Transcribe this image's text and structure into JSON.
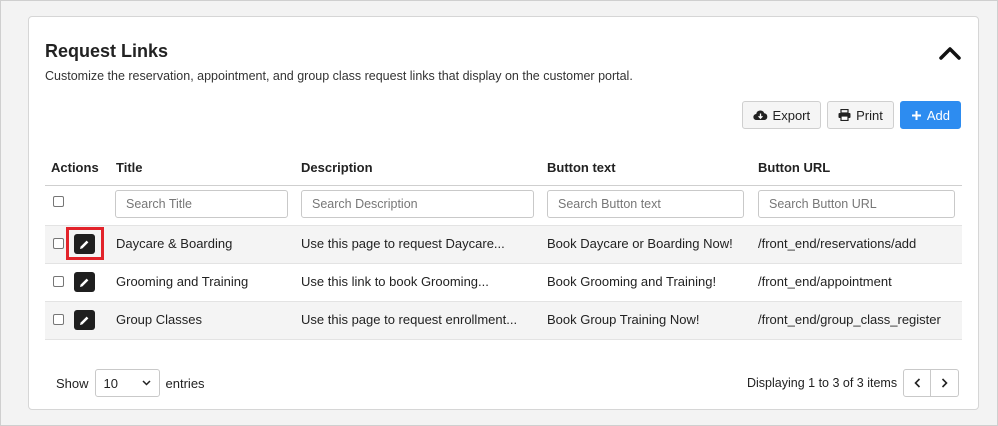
{
  "panel": {
    "title": "Request Links",
    "subtitle": "Customize the reservation, appointment, and group class request links that display on the customer portal.",
    "collapse_icon": "chevron-up-icon"
  },
  "toolbar": {
    "export_label": "Export",
    "print_label": "Print",
    "add_label": "Add",
    "accent_color": "#2d8cf0"
  },
  "table": {
    "headers": {
      "actions": "Actions",
      "title": "Title",
      "description": "Description",
      "button_text": "Button text",
      "button_url": "Button URL"
    },
    "filters": {
      "title_placeholder": "Search Title",
      "description_placeholder": "Search Description",
      "button_text_placeholder": "Search Button text",
      "button_url_placeholder": "Search Button URL"
    },
    "rows": [
      {
        "title": "Daycare & Boarding",
        "description": "Use this page to request Daycare...",
        "button_text": "Book Daycare or Boarding Now!",
        "button_url": "/front_end/reservations/add"
      },
      {
        "title": "Grooming and Training",
        "description": "Use this link to book Grooming...",
        "button_text": "Book Grooming and Training!",
        "button_url": "/front_end/appointment"
      },
      {
        "title": "Group Classes",
        "description": "Use this page to request enrollment...",
        "button_text": "Book Group Training Now!",
        "button_url": "/front_end/group_class_register"
      }
    ]
  },
  "footer": {
    "show_label": "Show",
    "page_size": "10",
    "entries_label": "entries",
    "info": "Displaying 1 to 3 of 3 items"
  }
}
